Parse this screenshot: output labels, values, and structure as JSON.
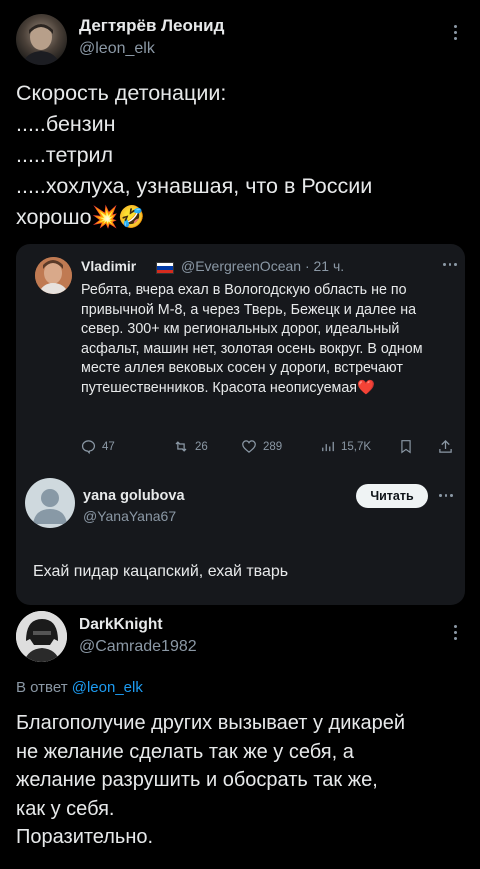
{
  "post": {
    "author_name": "Дегтярёв Леонид",
    "author_handle": "@leon_elk",
    "text": "Скорость детонации:\n.....бензин\n.....тетрил\n.....хохлуха, узнавшая, что в России\nхорошо💥🤣"
  },
  "quoted": {
    "author_name": "Vladimir",
    "author_flag": "russia-flag",
    "author_handle": "@EvergreenOcean",
    "time": "· 21 ч.",
    "text": "Ребята, вчера ехал в Вологодскую область не по привычной М-8, а через Тверь, Бежецк и далее на север. 300+ км региональных дорог, идеальный асфальт, машин нет, золотая осень вокруг. В одном месте аллея вековых сосен у дороги, встречают путешественников. Красота неописуемая❤️",
    "stats": {
      "replies": "47",
      "retweets": "26",
      "likes": "289",
      "views": "15,7K"
    },
    "reply": {
      "author_name": "yana golubova",
      "author_handle": "@YanaYana67",
      "follow_label": "Читать",
      "text": "Ехай пидар кацапский, ехай тварь"
    }
  },
  "reply_post": {
    "author_name": "DarkKnight",
    "author_handle": "@Camrade1982",
    "reply_to_prefix": "В ответ",
    "reply_to_handle": "@leon_elk",
    "text": "Благополучие других вызывает у дикарей\nне желание сделать так же у себя, а\nжелание разрушить и обосрать так же,\nкак у себя.\nПоразительно."
  },
  "colors": {
    "background": "#000000",
    "card": "#16181c",
    "muted": "#8b98a5",
    "link": "#1d9bf0"
  }
}
